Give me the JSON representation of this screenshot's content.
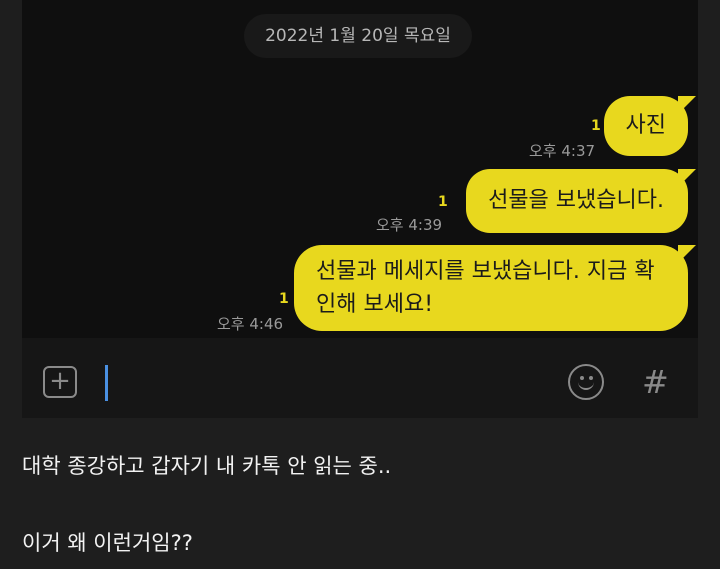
{
  "chat": {
    "date": "2022년 1월 20일 목요일",
    "messages": [
      {
        "text": "사진",
        "unread": "1",
        "time": "오후 4:37"
      },
      {
        "text": "선물을 보냈습니다.",
        "unread": "1",
        "time": "오후 4:39"
      },
      {
        "text": "선물과 메세지를 보냈습니다. 지금 확인해 보세요!",
        "unread": "1",
        "time": "오후 4:46"
      }
    ]
  },
  "input_bar": {
    "plus_icon": "plus-square-icon",
    "emoji_icon": "smiley-icon",
    "hash_label": "#",
    "accent_color": "#e8d81e",
    "cursor_color": "#4a90e2"
  },
  "post": {
    "line1": "대학 종강하고 갑자기 내 카톡 안 읽는 중..",
    "line2": "이거 왜 이런거임??"
  }
}
